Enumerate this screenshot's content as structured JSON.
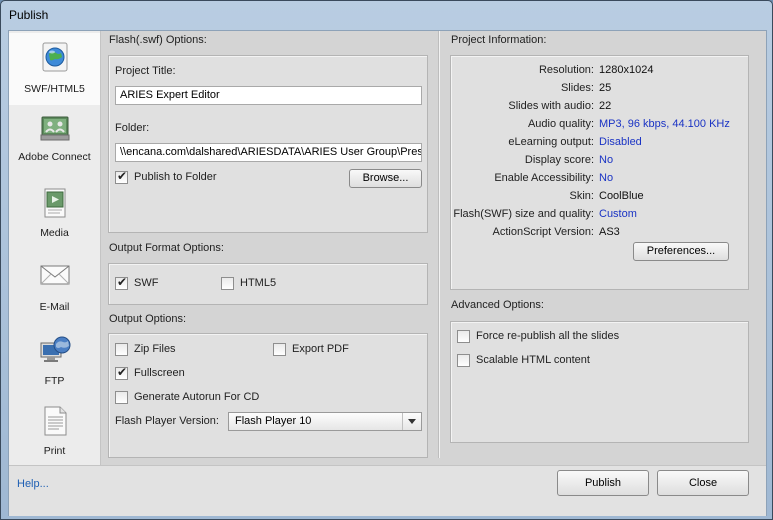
{
  "window": {
    "title": "Publish"
  },
  "sidebar": {
    "items": [
      {
        "label": "SWF/HTML5",
        "icon": "globe-icon",
        "active": true
      },
      {
        "label": "Adobe Connect",
        "icon": "adobe-connect-icon",
        "active": false
      },
      {
        "label": "Media",
        "icon": "film-document-icon",
        "active": false
      },
      {
        "label": "E-Mail",
        "icon": "envelope-icon",
        "active": false
      },
      {
        "label": "FTP",
        "icon": "network-globe-icon",
        "active": false
      },
      {
        "label": "Print",
        "icon": "printed-document-icon",
        "active": false
      }
    ]
  },
  "flash_options": {
    "section_title": "Flash(.swf) Options:",
    "project_title_label": "Project Title:",
    "project_title_value": "ARIES Expert Editor",
    "folder_label": "Folder:",
    "folder_value": "\\\\encana.com\\dalshared\\ARIESDATA\\ARIES User Group\\Presen",
    "publish_to_folder_label": "Publish to Folder",
    "publish_to_folder_checked": true,
    "browse_label": "Browse..."
  },
  "output_format": {
    "section_title": "Output Format Options:",
    "swf_label": "SWF",
    "swf_checked": true,
    "html5_label": "HTML5",
    "html5_checked": false
  },
  "output_options": {
    "section_title": "Output Options:",
    "zip_files_label": "Zip Files",
    "zip_files_checked": false,
    "export_pdf_label": "Export PDF",
    "export_pdf_checked": false,
    "fullscreen_label": "Fullscreen",
    "fullscreen_checked": true,
    "autorun_label": "Generate Autorun For CD",
    "autorun_checked": false,
    "flash_player_label": "Flash Player Version:",
    "flash_player_value": "Flash Player 10"
  },
  "project_info": {
    "section_title": "Project Information:",
    "rows": [
      {
        "key": "Resolution:",
        "value": "1280x1024",
        "link": false
      },
      {
        "key": "Slides:",
        "value": "25",
        "link": false
      },
      {
        "key": "Slides with audio:",
        "value": "22",
        "link": false
      },
      {
        "key": "Audio quality:",
        "value": "MP3, 96 kbps, 44.100 KHz",
        "link": true
      },
      {
        "key": "eLearning output:",
        "value": "Disabled",
        "link": true
      },
      {
        "key": "Display score:",
        "value": "No",
        "link": true
      },
      {
        "key": "Enable Accessibility:",
        "value": "No",
        "link": true
      },
      {
        "key": "Skin:",
        "value": "CoolBlue",
        "link": false
      },
      {
        "key": "Flash(SWF) size and quality:",
        "value": "Custom",
        "link": true
      },
      {
        "key": "ActionScript Version:",
        "value": "AS3",
        "link": false
      }
    ],
    "preferences_label": "Preferences..."
  },
  "advanced_options": {
    "section_title": "Advanced Options:",
    "force_republish_label": "Force re-publish all the slides",
    "force_republish_checked": false,
    "scalable_html_label": "Scalable HTML content",
    "scalable_html_checked": false
  },
  "footer": {
    "help_label": "Help...",
    "publish_label": "Publish",
    "close_label": "Close"
  },
  "colors": {
    "link": "#1a33c4",
    "help_link": "#1e5fb3",
    "panel_bg": "#e0e0e0",
    "window_frame": "#a9c0d9"
  }
}
